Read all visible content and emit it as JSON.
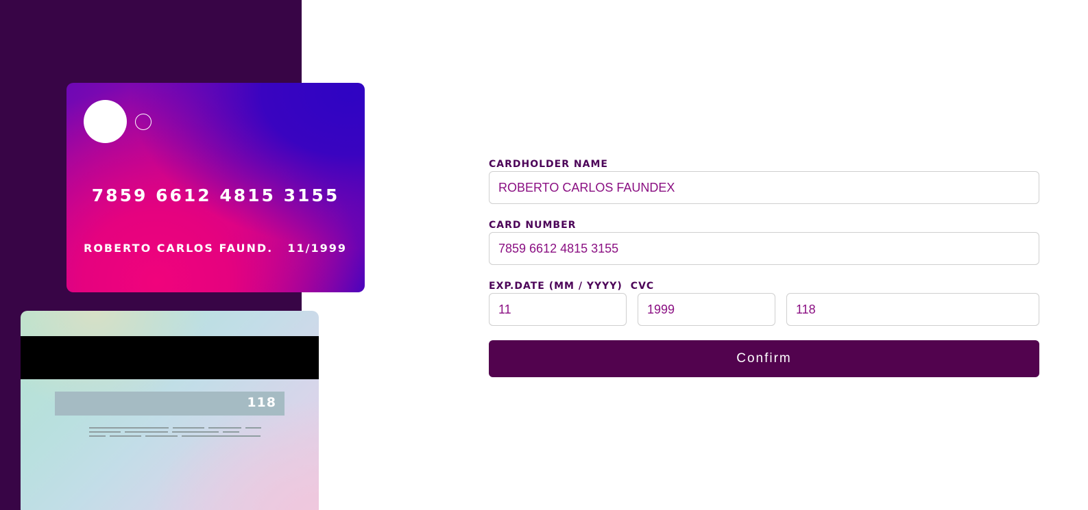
{
  "colors": {
    "sidebar_bg": "#380546",
    "label": "#4c0458",
    "input_text": "#8a0f82",
    "button_bg": "#52034e"
  },
  "card_front": {
    "number": "7859 6612 4815 3155",
    "name": "ROBERTO CARLOS FAUND.",
    "expiry": "11/1999"
  },
  "card_back": {
    "cvc": "118"
  },
  "form": {
    "cardholder_label": "CARDHOLDER NAME",
    "cardholder_value": "ROBERTO CARLOS FAUNDEX",
    "card_number_label": "CARD NUMBER",
    "card_number_value": "7859 6612 4815 3155",
    "exp_label": "EXP.DATE (MM / YYYY)",
    "cvc_label": "CVC",
    "exp_month_value": "11",
    "exp_year_value": "1999",
    "cvc_value": "118",
    "confirm_label": "Confirm"
  }
}
